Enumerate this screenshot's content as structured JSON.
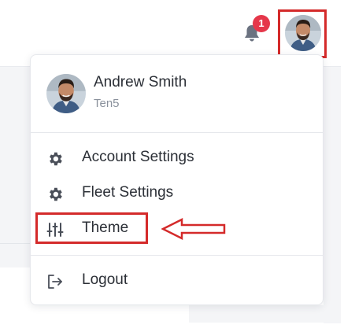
{
  "header": {
    "notification_count": "1",
    "avatar_alt": "profile-avatar"
  },
  "profile": {
    "name": "Andrew Smith",
    "organization": "Ten5"
  },
  "menu": {
    "items": [
      {
        "label": "Account Settings",
        "icon": "gear-icon"
      },
      {
        "label": "Fleet Settings",
        "icon": "gear-icon"
      },
      {
        "label": "Theme",
        "icon": "sliders-icon"
      }
    ],
    "logout": {
      "label": "Logout",
      "icon": "logout-icon"
    }
  },
  "colors": {
    "badge": "#e5374a",
    "highlight": "#d42a2a",
    "text": "#2b2f36",
    "muted": "#8a919c",
    "icon": "#4a4f59"
  }
}
